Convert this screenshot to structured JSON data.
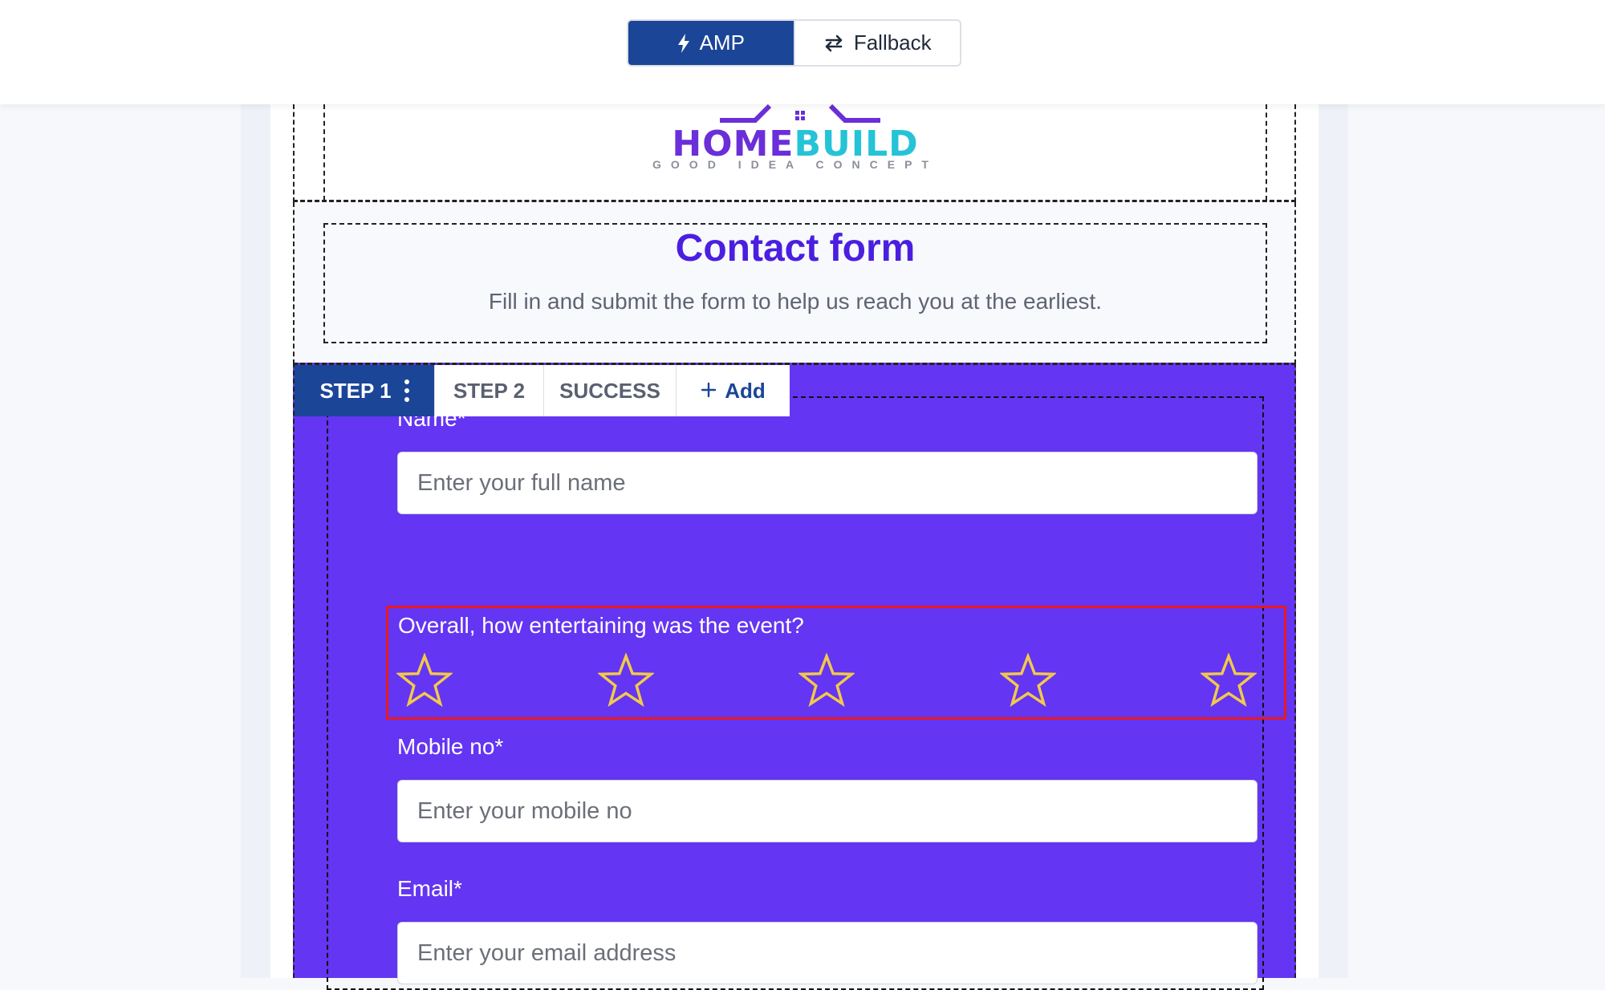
{
  "toolbar": {
    "amp_label": "AMP",
    "fallback_label": "Fallback",
    "active": "AMP"
  },
  "logo": {
    "word_home": "HOME",
    "word_build": "BUILD",
    "tagline": "GOOD IDEA CONCEPT"
  },
  "heading": {
    "title": "Contact form",
    "subtitle": "Fill in and submit the form to help us reach you at the earliest."
  },
  "tabs": [
    {
      "label": "STEP 1",
      "active": true
    },
    {
      "label": "STEP 2",
      "active": false
    },
    {
      "label": "SUCCESS",
      "active": false
    },
    {
      "label": "Add",
      "active": false
    }
  ],
  "form": {
    "name": {
      "label": "Name*",
      "placeholder": "Enter your full name",
      "value": ""
    },
    "rating": {
      "label": "Overall, how entertaining was the event?",
      "max": 5,
      "value": 0
    },
    "mobile": {
      "label": "Mobile no*",
      "placeholder": "Enter your mobile no",
      "value": ""
    },
    "email": {
      "label": "Email*",
      "placeholder": "Enter your email address",
      "value": ""
    }
  },
  "colors": {
    "primary": "#1b4597",
    "form_background": "#6435f2",
    "title": "#4a1fe0",
    "star": "#f2c94c",
    "highlight": "#e8191e"
  },
  "icons": {
    "amp": "lightning-icon",
    "fallback": "swap-arrows-icon",
    "tab_menu": "kebab-menu-icon",
    "add": "plus-icon",
    "rating": "star-outline-icon"
  }
}
